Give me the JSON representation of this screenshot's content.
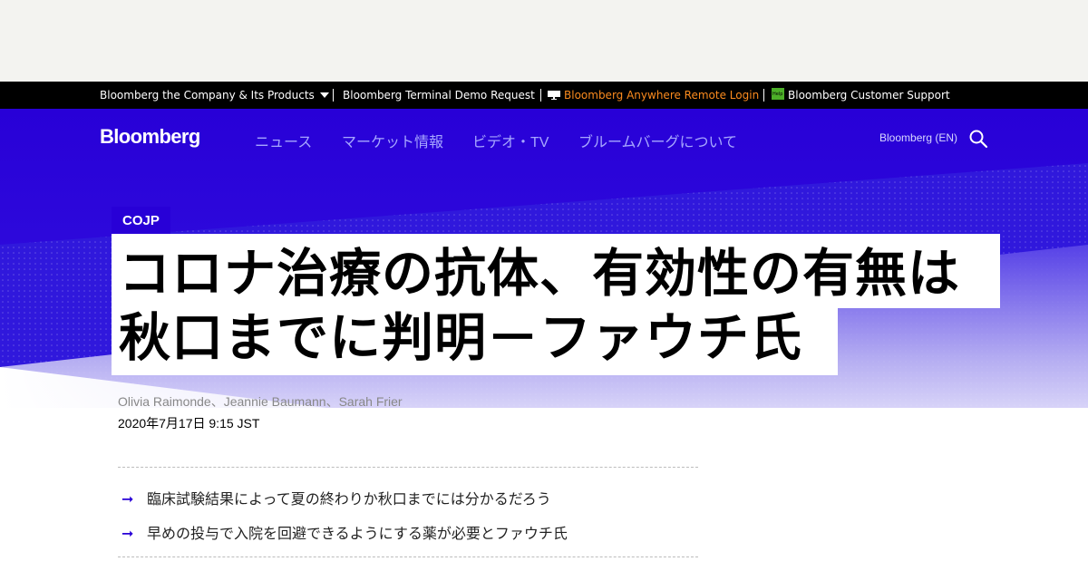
{
  "topbar": {
    "company_products": "Bloomberg the Company & Its Products",
    "terminal_demo": "Bloomberg Terminal Demo Request",
    "anywhere_login": "Bloomberg Anywhere Remote Login",
    "customer_support": "Bloomberg Customer Support"
  },
  "header": {
    "logo": "Bloomberg",
    "nav": [
      "ニュース",
      "マーケット情報",
      "ビデオ・TV",
      "ブルームバーグについて"
    ],
    "edition": "Bloomberg (EN)"
  },
  "article": {
    "kicker": "COJP",
    "headline_line1": "コロナ治療の抗体、有効性の有無は",
    "headline_line2": "秋口までに判明－ファウチ氏",
    "byline": "Olivia Raimonde、Jeannie Baumann、Sarah Frier",
    "date": "2020年7月17日 9:15 JST",
    "summary": [
      "臨床試験結果によって夏の終わりか秋口までには分かるだろう",
      "早めの投与で入院を回避できるようにする薬が必要とファウチ氏"
    ],
    "bullet_glyph": "➞"
  },
  "colors": {
    "brand_blue": "#2800d7",
    "nav_text": "#a7a7ff",
    "anywhere_orange": "#fb8b1e",
    "help_green": "#4caf28"
  }
}
